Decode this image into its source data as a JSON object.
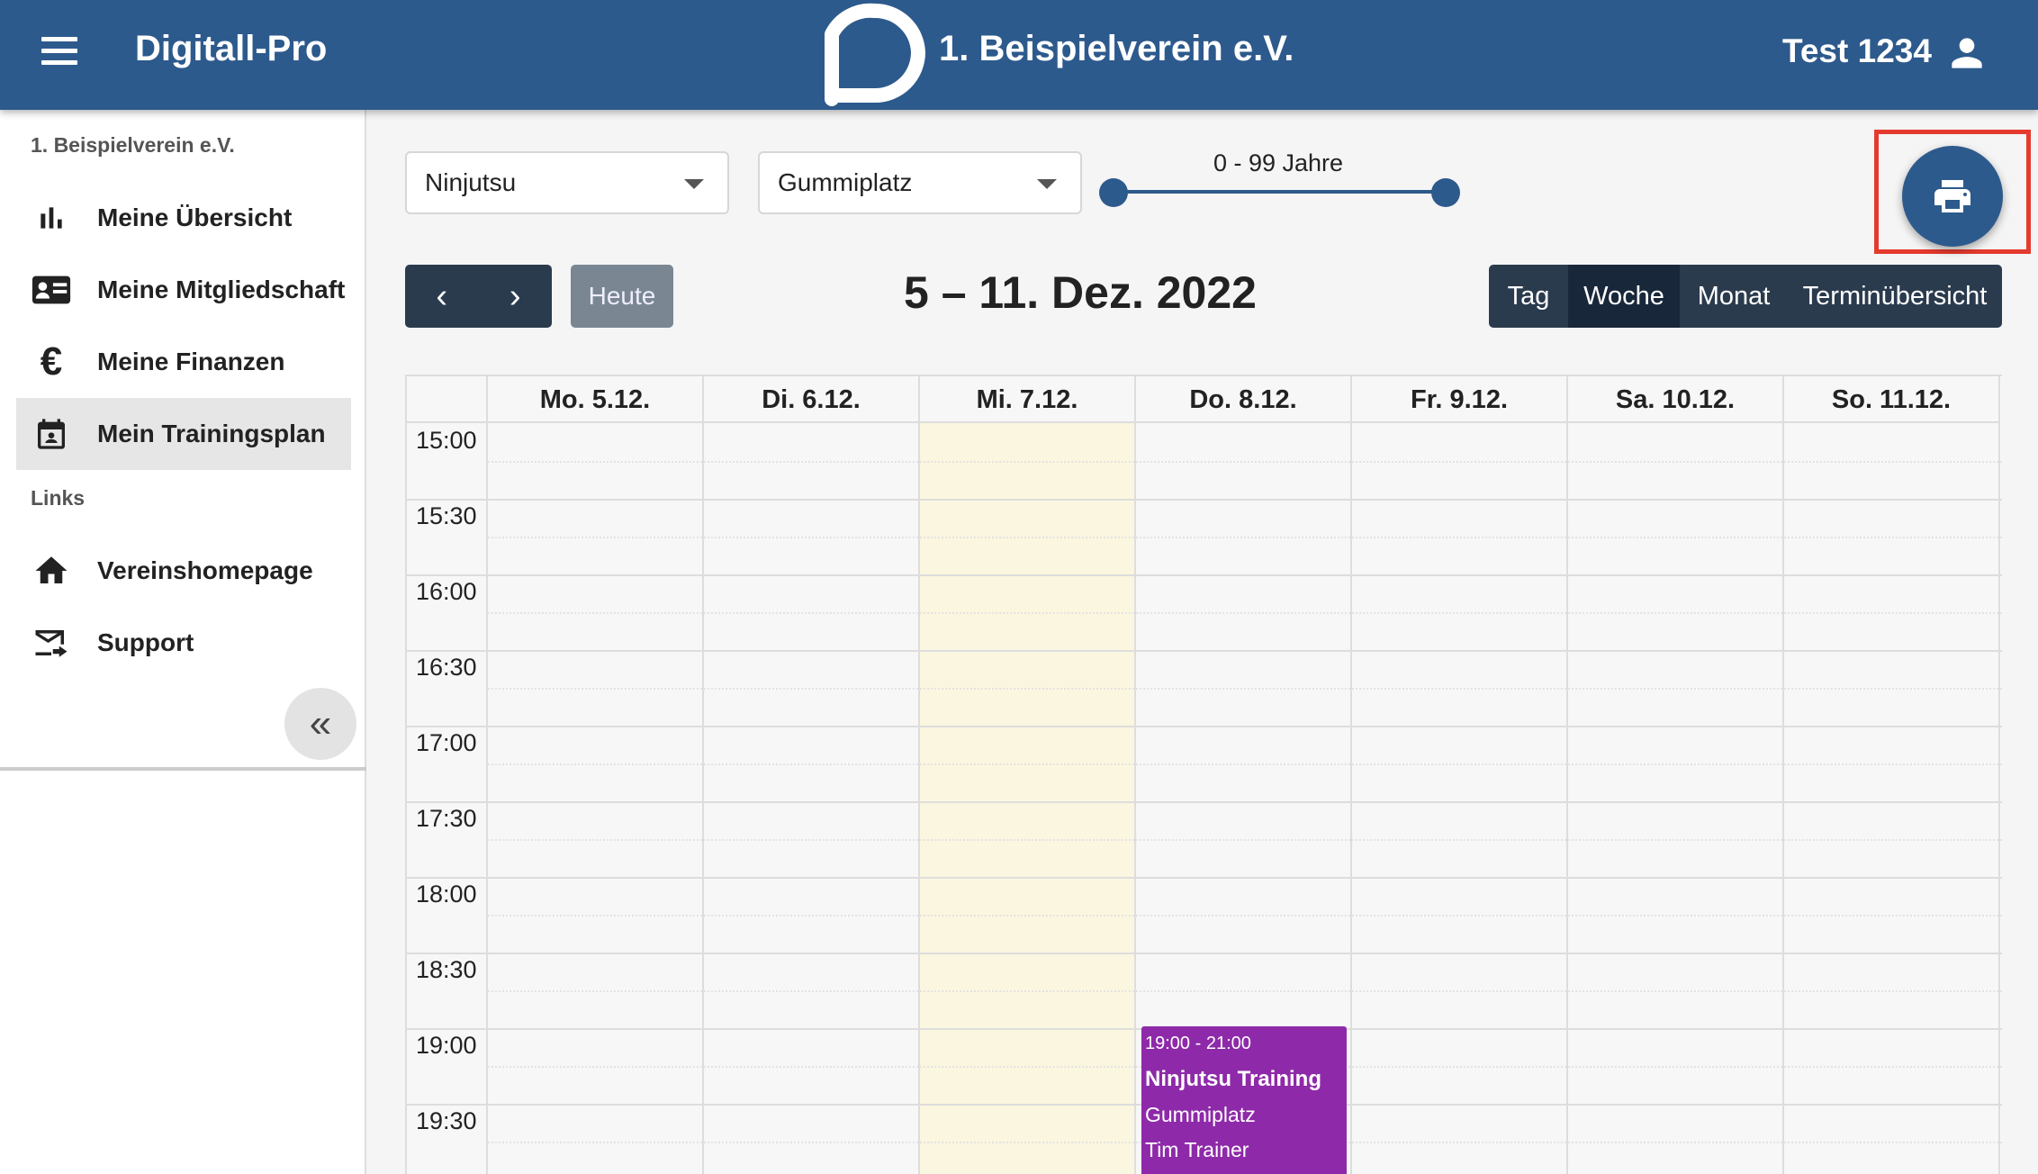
{
  "header": {
    "app_title": "Digitall-Pro",
    "club_name": "1. Beispielverein e.V.",
    "user_name": "Test 1234"
  },
  "sidebar": {
    "club_label": "1. Beispielverein e.V.",
    "links_label": "Links",
    "items": [
      {
        "label": "Meine Übersicht",
        "icon": "bar-chart-icon"
      },
      {
        "label": "Meine Mitgliedschaft",
        "icon": "id-card-icon"
      },
      {
        "label": "Meine Finanzen",
        "icon": "euro-icon"
      },
      {
        "label": "Mein Trainingsplan",
        "icon": "calendar-icon",
        "active": true
      }
    ],
    "links": [
      {
        "label": "Vereinshomepage",
        "icon": "home-icon"
      },
      {
        "label": "Support",
        "icon": "mail-forward-icon"
      }
    ],
    "collapse_glyph": "«"
  },
  "filters": {
    "sport": "Ninjutsu",
    "location": "Gummiplatz",
    "age_range_label": "0 - 99 Jahre",
    "age_min": 0,
    "age_max": 99
  },
  "toolbar": {
    "prev_glyph": "‹",
    "next_glyph": "›",
    "today_label": "Heute",
    "range_title": "5 – 11. Dez. 2022",
    "views": [
      "Tag",
      "Woche",
      "Monat",
      "Terminübersicht"
    ],
    "active_view": "Woche"
  },
  "calendar": {
    "days": [
      "Mo. 5.12.",
      "Di. 6.12.",
      "Mi. 7.12.",
      "Do. 8.12.",
      "Fr. 9.12.",
      "Sa. 10.12.",
      "So. 11.12."
    ],
    "today_index": 2,
    "times": [
      "15:00",
      "15:30",
      "16:00",
      "16:30",
      "17:00",
      "17:30",
      "18:00",
      "18:30",
      "19:00",
      "19:30"
    ],
    "event": {
      "time": "19:00 - 21:00",
      "title": "Ninjutsu Training",
      "place": "Gummiplatz",
      "trainer": "Tim Trainer",
      "day_index": 3,
      "color": "#8e2aa9"
    }
  },
  "colors": {
    "primary": "#2d5a8c",
    "toolbar_dark": "#2b3b4e",
    "today_highlight": "#fbf6df",
    "print_highlight": "#e53a2e"
  }
}
